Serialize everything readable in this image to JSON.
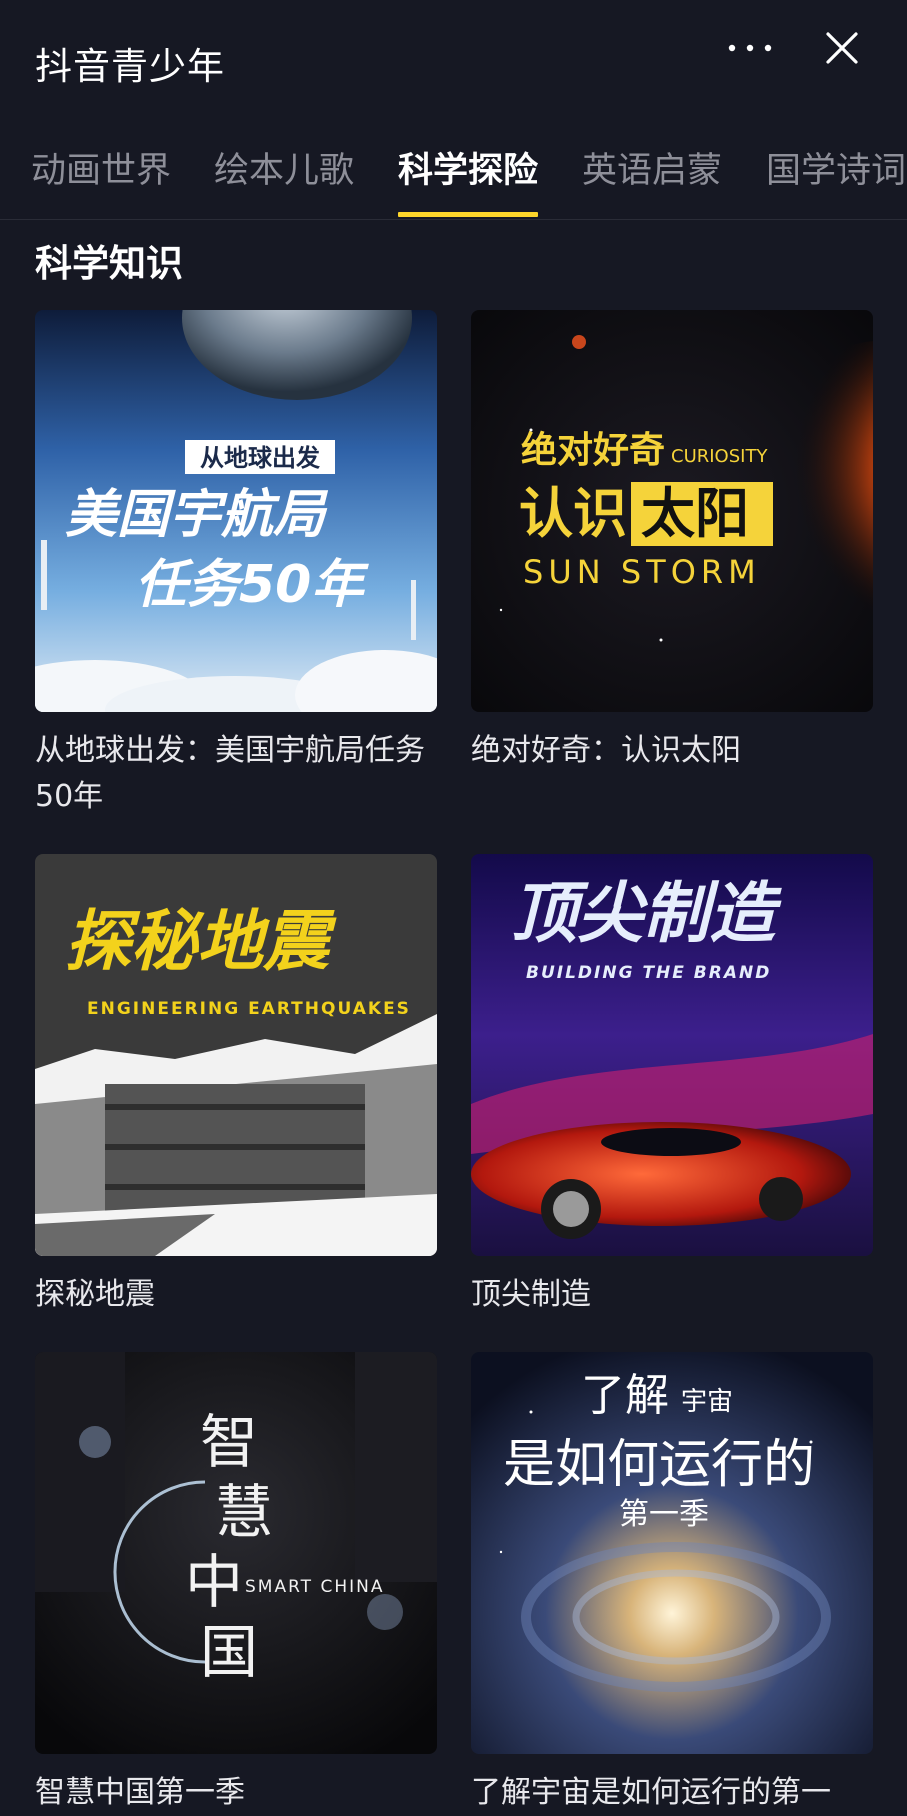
{
  "header": {
    "title": "抖音青少年",
    "more_icon": "more-horizontal-icon",
    "close_icon": "close-icon"
  },
  "tabs": [
    {
      "label": "动画世界",
      "active": false
    },
    {
      "label": "绘本儿歌",
      "active": false
    },
    {
      "label": "科学探险",
      "active": true
    },
    {
      "label": "英语启蒙",
      "active": false
    },
    {
      "label": "国学诗词",
      "active": false
    }
  ],
  "colors": {
    "background": "#161823",
    "accent": "#fdd52b",
    "tab_inactive": "#8e8f99"
  },
  "section": {
    "title": "科学知识"
  },
  "cards": [
    {
      "title": "从地球出发：美国宇航局任务50年",
      "cover": {
        "badge": "从地球出发",
        "line1": "美国宇航局",
        "line2": "任务50年"
      }
    },
    {
      "title": "绝对好奇：认识太阳",
      "cover": {
        "line1": "绝对好奇",
        "line1_en": "CURIOSITY",
        "line2a": "认识",
        "line2b": "太阳",
        "line3": "SUN STORM"
      }
    },
    {
      "title": "探秘地震",
      "cover": {
        "line1": "探秘地震",
        "line2": "ENGINEERING EARTHQUAKES"
      }
    },
    {
      "title": "顶尖制造",
      "cover": {
        "line1": "顶尖制造",
        "line2": "BUILDING THE BRAND"
      }
    },
    {
      "title": "智慧中国第一季",
      "cover": {
        "c1": "智",
        "c2": "慧",
        "c3": "中",
        "c4": "国",
        "en": "SMART CHINA"
      }
    },
    {
      "title": "了解宇宙是如何运行的第一",
      "cover": {
        "line1a": "了解",
        "line1b": "宇宙",
        "line2": "是如何运行的",
        "line3": "第一季"
      }
    }
  ]
}
